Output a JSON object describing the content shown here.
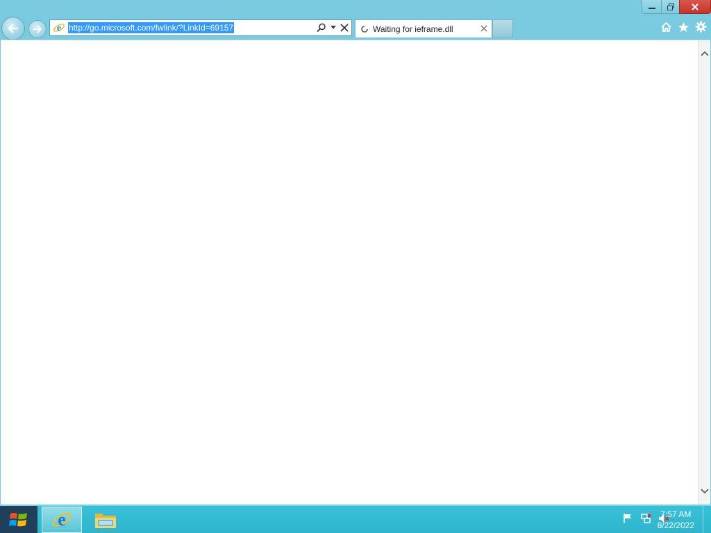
{
  "browser": {
    "address_bar": {
      "url": "http://go.microsoft.com/fwlink/?LinkId=69157"
    },
    "tab": {
      "title": "Waiting for ieframe.dll"
    }
  },
  "taskbar": {
    "clock": {
      "time": "7:57 AM",
      "date": "8/22/2022"
    }
  }
}
